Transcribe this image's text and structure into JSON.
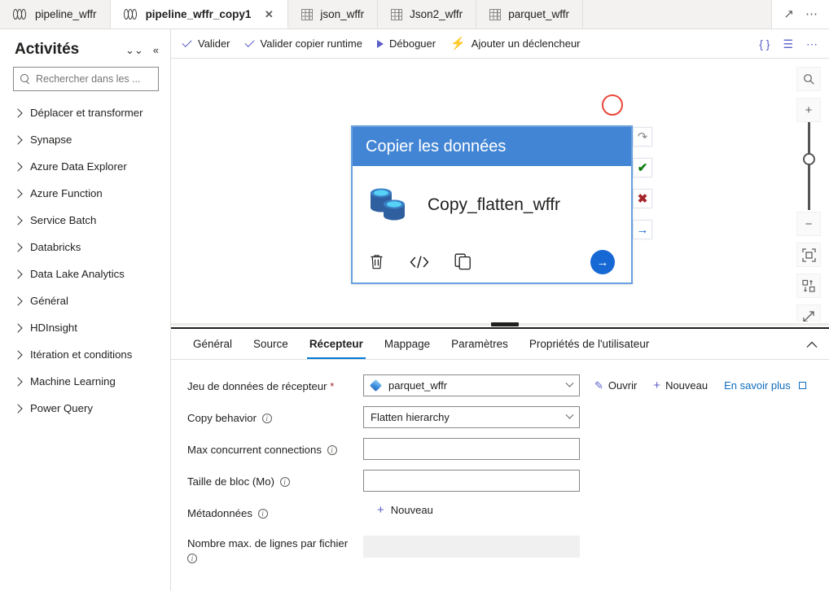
{
  "tabs": [
    {
      "label": "pipeline_wffr",
      "icon": "pipeline-icon",
      "active": false,
      "closable": false
    },
    {
      "label": "pipeline_wffr_copy1",
      "icon": "pipeline-icon",
      "active": true,
      "closable": true,
      "close_label": "✕"
    },
    {
      "label": "json_wffr",
      "icon": "dataset-grid-icon",
      "active": false,
      "closable": false
    },
    {
      "label": "Json2_wffr",
      "icon": "dataset-grid-icon",
      "active": false,
      "closable": false
    },
    {
      "label": "parquet_wffr",
      "icon": "dataset-grid-icon",
      "active": false,
      "closable": false
    }
  ],
  "tabbar_actions": {
    "expand_icon": "↗",
    "more_icon": "⋯"
  },
  "sidebar": {
    "title": "Activités",
    "collapse_all_icon": "»",
    "chevrons_down_icon": "⌄⌄",
    "collapse_panel_icon": "«",
    "search": {
      "placeholder": "Rechercher dans les ...",
      "value": "",
      "icon": "search-icon"
    },
    "items": [
      {
        "label": "Déplacer et transformer"
      },
      {
        "label": "Synapse"
      },
      {
        "label": "Azure Data Explorer"
      },
      {
        "label": "Azure Function"
      },
      {
        "label": "Service Batch"
      },
      {
        "label": "Databricks"
      },
      {
        "label": "Data Lake Analytics"
      },
      {
        "label": "Général"
      },
      {
        "label": "HDInsight"
      },
      {
        "label": "Itération et conditions"
      },
      {
        "label": "Machine Learning"
      },
      {
        "label": "Power Query"
      }
    ]
  },
  "toolbar": {
    "validate_label": "Valider",
    "validate_runtime_label": "Valider copier runtime",
    "debug_label": "Déboguer",
    "trigger_label": "Ajouter un déclencheur",
    "code_icon": "{ }",
    "properties_icon": "☰",
    "more_icon": "⋯"
  },
  "canvas": {
    "activity": {
      "header_title": "Copier les données",
      "name": "Copy_flatten_wffr",
      "icon": "copy-data-database-icon",
      "footer_actions": [
        {
          "icon": "trash-icon",
          "glyph": "🗑"
        },
        {
          "icon": "code-icon",
          "glyph": "‹/›"
        },
        {
          "icon": "clone-icon",
          "glyph": "❐"
        }
      ],
      "next_arrow_glyph": "→",
      "side_actions": [
        {
          "icon": "rerun-upon-skip-icon",
          "glyph": "↷",
          "color": "#8a8886"
        },
        {
          "icon": "on-success-icon",
          "glyph": "✔",
          "color": "#107c10"
        },
        {
          "icon": "on-failure-icon",
          "glyph": "✖",
          "color": "#a4262c"
        },
        {
          "icon": "on-completion-icon",
          "glyph": "→",
          "color": "#1668d4"
        }
      ]
    },
    "annotation": {
      "shape": "red-circle-highlight",
      "color": "#e8483a"
    },
    "zoom_controls": {
      "search_icon": "⚲",
      "zoom_in_icon": "+",
      "zoom_out_icon": "−",
      "fit_icon": "⧉",
      "auto_align_icon": "⇅",
      "expand_icon": "⤡"
    }
  },
  "panel": {
    "tabs": [
      {
        "label": "Général",
        "active": false
      },
      {
        "label": "Source",
        "active": false
      },
      {
        "label": "Récepteur",
        "active": true
      },
      {
        "label": "Mappage",
        "active": false
      },
      {
        "label": "Paramètres",
        "active": false
      },
      {
        "label": "Propriétés de l'utilisateur",
        "active": false
      }
    ],
    "collapse_icon": "⌃",
    "fields": {
      "sink_dataset": {
        "label": "Jeu de données de récepteur",
        "required_mark": "*",
        "value": "parquet_wffr",
        "icon": "dataset-diamond-icon",
        "open_label": "Ouvrir",
        "open_icon": "pencil-icon",
        "new_label": "Nouveau",
        "new_icon": "plus-icon",
        "learn_more_label": "En savoir plus",
        "learn_more_icon": "external-link-icon"
      },
      "copy_behavior": {
        "label": "Copy behavior",
        "info_icon": "i",
        "value": "Flatten hierarchy"
      },
      "max_concurrent_connections": {
        "label": "Max concurrent connections",
        "info_icon": "i",
        "value": "",
        "placeholder": ""
      },
      "block_size": {
        "label": "Taille de bloc (Mo)",
        "info_icon": "i",
        "value": "",
        "placeholder": ""
      },
      "metadata": {
        "label": "Métadonnées",
        "info_icon": "i",
        "new_label": "Nouveau",
        "new_icon": "plus-icon"
      },
      "max_rows_per_file": {
        "label": "Nombre max. de lignes par fichier",
        "info_icon": "i",
        "value": "",
        "disabled": true
      }
    }
  },
  "colors": {
    "accent_blue": "#0078d4",
    "activity_header_blue": "#4285d4",
    "link_purple": "#5b5fc7",
    "success_green": "#107c10",
    "error_red": "#a4262c",
    "highlight_red": "#e8483a"
  }
}
